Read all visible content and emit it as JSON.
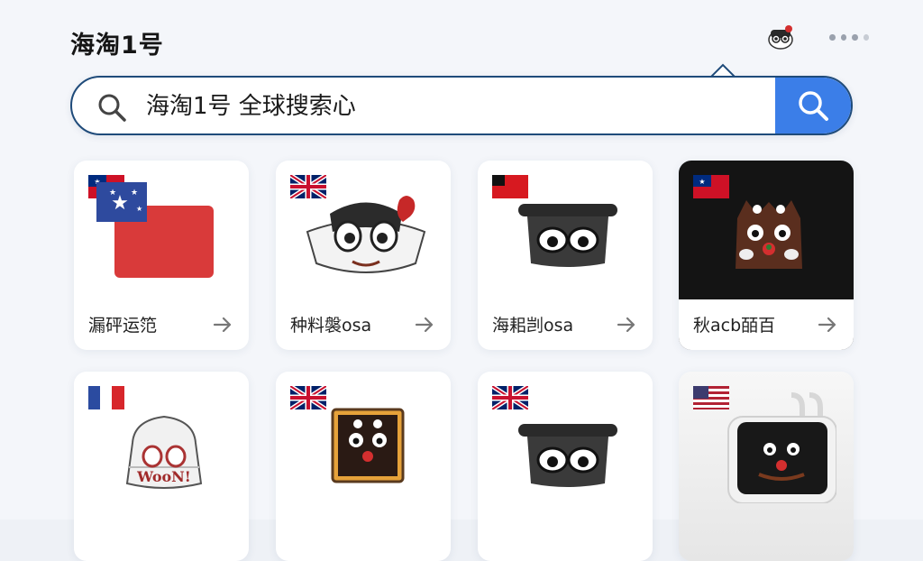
{
  "header": {
    "title": "海淘1号",
    "mascot_icon": "mascot-avatar-icon",
    "more_icon": "more-dots-icon"
  },
  "search": {
    "value": "海淘1号 全球搜索心",
    "search_icon": "search-icon",
    "submit_icon": "search-icon",
    "accent": "#3b7ee8",
    "border": "#1f4b7a"
  },
  "cards": [
    {
      "label": "漏砰运笵",
      "flag": "samoa-flag",
      "art": "samoa-flag-large"
    },
    {
      "label": "种料褩osa",
      "flag": "uk-flag",
      "art": "mascot-face"
    },
    {
      "label": "海耜剀osa",
      "flag": "red-flag",
      "art": "mascot-hat-face"
    },
    {
      "label": "秋acb皕百",
      "flag": "samoa-flag",
      "art": "mascot-group-dark"
    },
    {
      "label": "",
      "flag": "france-flag",
      "art": "mascot-woon"
    },
    {
      "label": "",
      "flag": "uk-flag",
      "art": "mascot-framed"
    },
    {
      "label": "",
      "flag": "uk-flag",
      "art": "mascot-hat-face"
    },
    {
      "label": "",
      "flag": "us-flag",
      "art": "mascot-device"
    }
  ],
  "arrow_icon": "arrow-right-icon"
}
